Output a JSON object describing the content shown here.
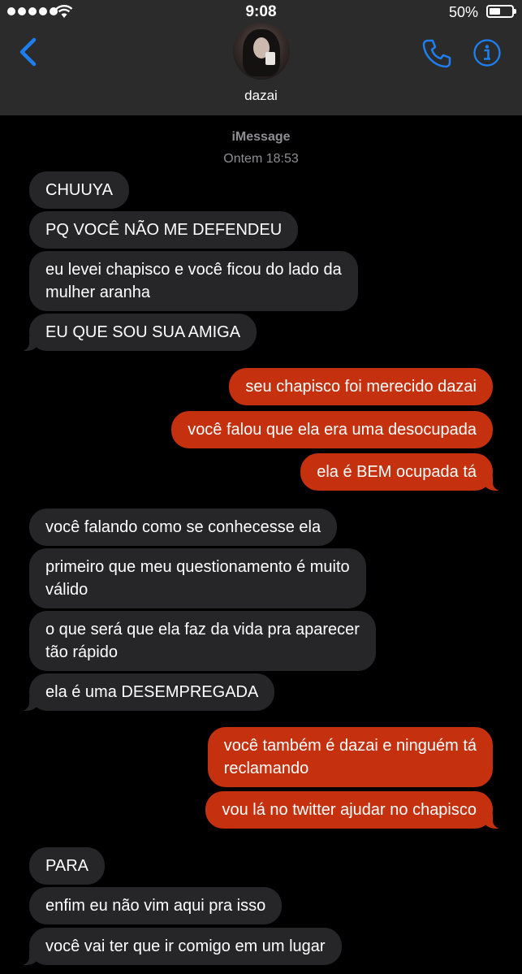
{
  "status_bar": {
    "time": "9:08",
    "battery": "50%"
  },
  "header": {
    "contact_name": "dazai",
    "back_icon": "chevron-left-icon",
    "call_icon": "phone-icon",
    "info_icon": "info-icon",
    "accent_color": "#1e7ff0"
  },
  "thread": {
    "service": "iMessage",
    "timestamp": "Ontem 18:53"
  },
  "messages": [
    {
      "from": "contact",
      "lines": [
        "CHUUYA"
      ]
    },
    {
      "from": "contact",
      "lines": [
        "PQ VOCÊ NÃO ME DEFENDEU"
      ]
    },
    {
      "from": "contact",
      "lines": [
        "eu levei chapisco e você ficou do lado da",
        "mulher aranha"
      ]
    },
    {
      "from": "contact",
      "lines": [
        "EU QUE SOU SUA AMIGA"
      ]
    },
    {
      "from": "me",
      "lines": [
        "seu chapisco foi merecido dazai"
      ]
    },
    {
      "from": "me",
      "lines": [
        "você falou que ela era uma desocupada"
      ]
    },
    {
      "from": "me",
      "lines": [
        "ela é BEM ocupada tá"
      ]
    },
    {
      "from": "contact",
      "lines": [
        "você falando como se conhecesse ela"
      ]
    },
    {
      "from": "contact",
      "lines": [
        "primeiro que meu questionamento é muito",
        "válido"
      ]
    },
    {
      "from": "contact",
      "lines": [
        "o que será que ela faz da vida pra aparecer",
        "tão rápido"
      ]
    },
    {
      "from": "contact",
      "lines": [
        "ela é uma DESEMPREGADA"
      ]
    },
    {
      "from": "me",
      "lines": [
        "você também é dazai e ninguém tá",
        "reclamando"
      ]
    },
    {
      "from": "me",
      "lines": [
        "vou lá no twitter ajudar no chapisco"
      ]
    },
    {
      "from": "contact",
      "lines": [
        "PARA"
      ]
    },
    {
      "from": "contact",
      "lines": [
        "enfim eu não vim aqui pra isso"
      ]
    },
    {
      "from": "contact",
      "lines": [
        "você vai ter que ir comigo em um lugar"
      ]
    }
  ],
  "colors": {
    "header_bg": "#2b2b2b",
    "incoming_bubble": "#262628",
    "outgoing_bubble": "#c5310f",
    "meta_text": "#8e8e93"
  }
}
